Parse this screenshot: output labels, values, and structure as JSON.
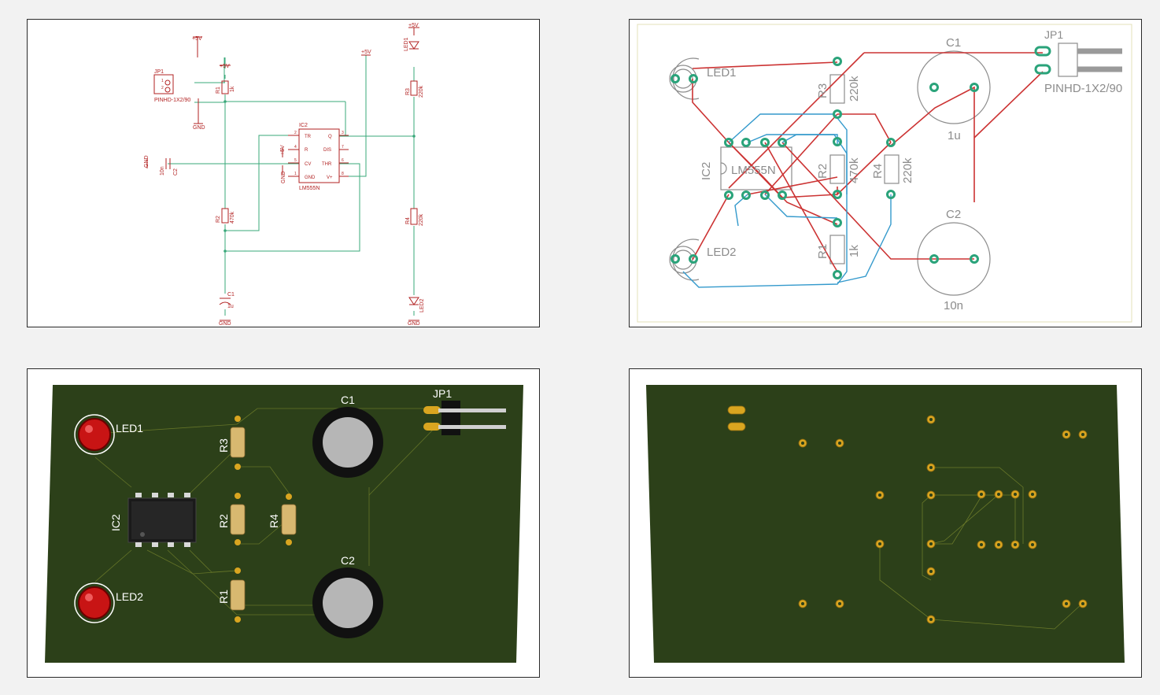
{
  "schematic": {
    "power_label": "+5V",
    "ground_label": "GND",
    "jp1": {
      "name": "JP1",
      "value": "PINHD-1X2/90",
      "pin1": "1",
      "pin2": "2"
    },
    "ic2": {
      "name": "IC2",
      "value": "LM555N",
      "pins_left": [
        {
          "num": "2",
          "label": "TR"
        },
        {
          "num": "4",
          "label": "R"
        },
        {
          "num": "5",
          "label": "CV"
        },
        {
          "num": "1",
          "label": "GND"
        }
      ],
      "pins_right": [
        {
          "num": "3",
          "label": "Q"
        },
        {
          "num": "7",
          "label": "DIS"
        },
        {
          "num": "6",
          "label": "THR"
        },
        {
          "num": "8",
          "label": "V+"
        }
      ]
    },
    "r1": {
      "name": "R1",
      "value": "1k"
    },
    "r2": {
      "name": "R2",
      "value": "470k"
    },
    "r3": {
      "name": "R3",
      "value": "220k"
    },
    "r4": {
      "name": "R4",
      "value": "220k"
    },
    "c1": {
      "name": "C1",
      "value": "1u"
    },
    "c2": {
      "name": "C2",
      "value": "10n"
    },
    "led1": {
      "name": "LED1"
    },
    "led2": {
      "name": "LED2"
    }
  },
  "board": {
    "jp1": {
      "name": "JP1",
      "value": "PINHD-1X2/90"
    },
    "led1": {
      "name": "LED1"
    },
    "led2": {
      "name": "LED2"
    },
    "ic2": {
      "name": "IC2",
      "value": "LM555N"
    },
    "r1": {
      "name": "R1",
      "value": "1k"
    },
    "r2": {
      "name": "R2",
      "value": "470k"
    },
    "r3": {
      "name": "R3",
      "value": "220k"
    },
    "r4": {
      "name": "R4",
      "value": "220k"
    },
    "c1": {
      "name": "C1",
      "value": "1u"
    },
    "c2": {
      "name": "C2",
      "value": "10n"
    }
  },
  "render3d": {
    "jp1": "JP1",
    "led1": "LED1",
    "led2": "LED2",
    "ic2": "IC2",
    "r1": "R1",
    "r2": "R2",
    "r3": "R3",
    "r4": "R4",
    "c1": "C1",
    "c2": "C2"
  },
  "colors": {
    "schematic_symbol": "#b22222",
    "schematic_net": "#3aa87a",
    "pcb_top_trace": "#cc3333",
    "pcb_bottom_trace": "#3399cc",
    "pcb_pad": "#2aa37a",
    "silkscreen": "#8c8c8c",
    "board_green": "#2c4019",
    "pad_gold": "#d9a520"
  }
}
